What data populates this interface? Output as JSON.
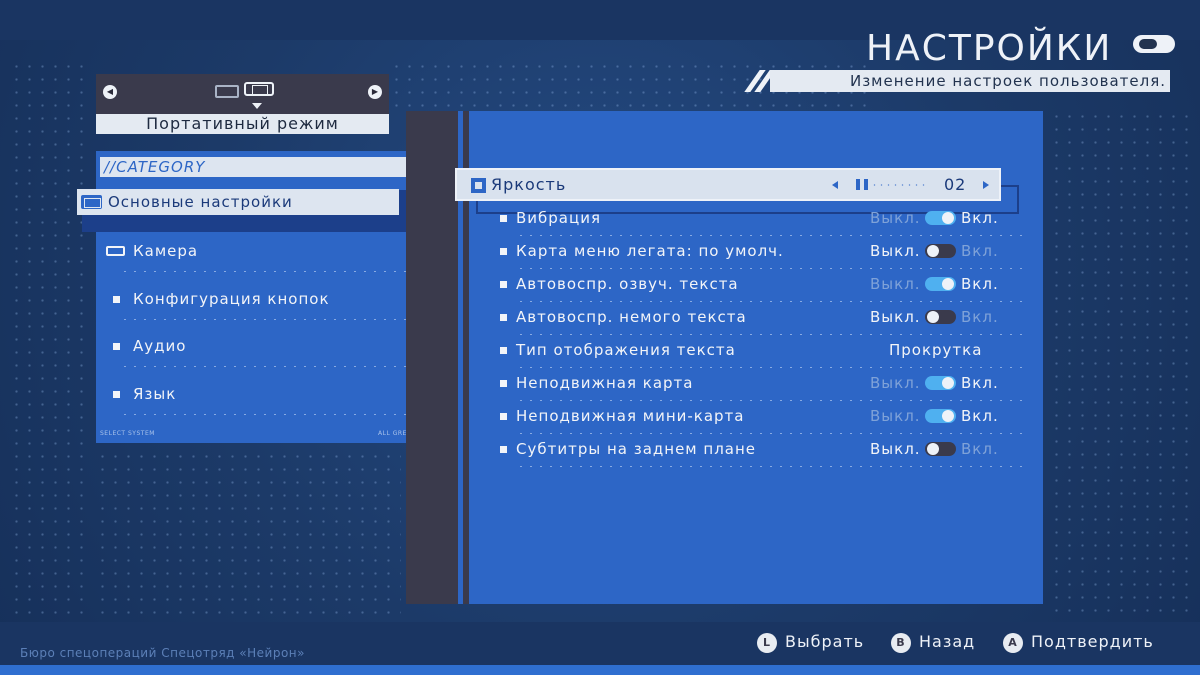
{
  "header": {
    "title": "НАСТРОЙКИ",
    "subtitle": "Изменение настроек пользователя."
  },
  "mode_selector": {
    "label": "Портативный режим",
    "icons": [
      "tv-icon",
      "handheld-icon"
    ]
  },
  "category": {
    "header": "//CATEGORY",
    "selected_index": 0,
    "items": [
      {
        "label": "Основные настройки",
        "icon": "handheld-icon"
      },
      {
        "label": "Камера",
        "icon": "camera-icon"
      },
      {
        "label": "Конфигурация кнопок",
        "icon": "bullet"
      },
      {
        "label": "Аудио",
        "icon": "bullet"
      },
      {
        "label": "Язык",
        "icon": "bullet"
      }
    ],
    "footer_left": "SELECT SYSTEM",
    "footer_right": "ALL GREEN"
  },
  "settings": {
    "brightness": {
      "label": "Яркость",
      "value": "02"
    },
    "off_label": "Выкл.",
    "on_label": "Вкл.",
    "rows": [
      {
        "label": "Вибрация",
        "state": "on"
      },
      {
        "label": "Карта меню легата: по умолч.",
        "state": "off"
      },
      {
        "label": "Автовоспр. озвуч. текста",
        "state": "on"
      },
      {
        "label": "Автовоспр. немого текста",
        "state": "off"
      },
      {
        "label": "Тип отображения текста",
        "value": "Прокрутка"
      },
      {
        "label": "Неподвижная карта",
        "state": "on"
      },
      {
        "label": "Неподвижная мини-карта",
        "state": "on"
      },
      {
        "label": "Субтитры на заднем плане",
        "state": "off"
      }
    ]
  },
  "footer": {
    "left_text": "Бюро спецопераций   Спецотряд «Нейрон»",
    "buttons": [
      {
        "key": "L",
        "label": "Выбрать"
      },
      {
        "key": "B",
        "label": "Назад"
      },
      {
        "key": "A",
        "label": "Подтвердить"
      }
    ]
  },
  "colors": {
    "background": "#1e3d6e",
    "panel_blue": "#2d66c6",
    "dark_strip": "#3a3a4c",
    "toggle_on": "#4fb0f0",
    "highlight": "#dde5f0"
  }
}
